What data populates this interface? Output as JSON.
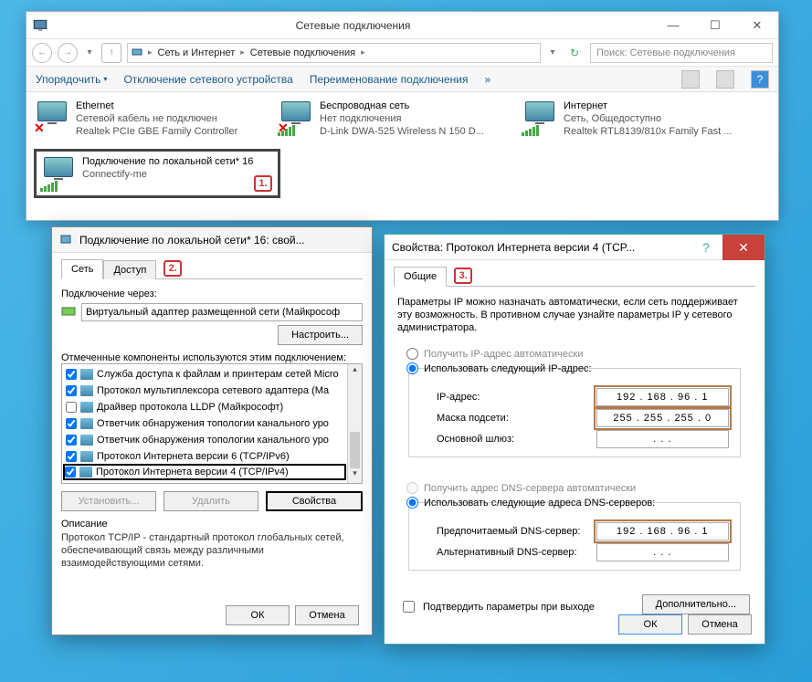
{
  "explorer": {
    "title": "Сетевые подключения",
    "back": "←",
    "fwd": "→",
    "up": "↑",
    "breadcrumb": {
      "seg1": "Сеть и Интернет",
      "seg2": "Сетевые подключения"
    },
    "search_placeholder": "Поиск: Сетевые подключения",
    "toolbar": {
      "arrange": "Упорядочить",
      "disable": "Отключение сетевого устройства",
      "rename": "Переименование подключения"
    },
    "connections": [
      {
        "name": "Ethernet",
        "status": "Сетевой кабель не подключен",
        "driver": "Realtek PCIe GBE Family Controller",
        "disconnected": true
      },
      {
        "name": "Беспроводная сеть",
        "status": "Нет подключения",
        "driver": "D-Link DWA-525 Wireless N 150 D...",
        "disconnected": true
      },
      {
        "name": "Интернет",
        "status": "Сеть, Общедоступно",
        "driver": "Realtek RTL8139/810x Family Fast ...",
        "disconnected": false
      }
    ],
    "selected": {
      "name": "Подключение по локальной сети* 16",
      "status": "Connectify-me"
    },
    "badge1": "1."
  },
  "dlg1": {
    "title": "Подключение по локальной сети* 16: свой...",
    "tabs": {
      "net": "Сеть",
      "access": "Доступ"
    },
    "badge2": "2.",
    "connect_via_label": "Подключение через:",
    "adapter": "Виртуальный адаптер размещенной сети (Майкрософ",
    "configure": "Настроить...",
    "components_label": "Отмеченные компоненты используются этим подключением:",
    "items": [
      {
        "checked": true,
        "text": "Служба доступа к файлам и принтерам сетей Micro"
      },
      {
        "checked": true,
        "text": "Протокол мультиплексора сетевого адаптера (Ма"
      },
      {
        "checked": false,
        "text": "Драйвер протокола LLDP (Майкрософт)"
      },
      {
        "checked": true,
        "text": "Ответчик обнаружения топологии канального уро"
      },
      {
        "checked": true,
        "text": "Ответчик обнаружения топологии канального уро"
      },
      {
        "checked": true,
        "text": "Протокол Интернета версии 6 (TCP/IPv6)"
      },
      {
        "checked": true,
        "text": "Протокол Интернета версии 4 (TCP/IPv4)"
      }
    ],
    "install": "Установить...",
    "remove": "Удалить",
    "properties": "Свойства",
    "desc_label": "Описание",
    "desc": "Протокол TCP/IP - стандартный протокол глобальных сетей, обеспечивающий связь между различными взаимодействующими сетями.",
    "ok": "ОК",
    "cancel": "Отмена"
  },
  "dlg2": {
    "title": "Свойства: Протокол Интернета версии 4 (TCP...",
    "tab_general": "Общие",
    "badge3": "3.",
    "intro": "Параметры IP можно назначать автоматически, если сеть поддерживает эту возможность. В противном случае узнайте параметры IP у сетевого администратора.",
    "auto_ip": "Получить IP-адрес автоматически",
    "use_ip": "Использовать следующий IP-адрес:",
    "ip_label": "IP-адрес:",
    "ip_val": "192 . 168 . 96 .  1",
    "mask_label": "Маска подсети:",
    "mask_val": "255 . 255 . 255 .  0",
    "gw_label": "Основной шлюз:",
    "gw_val": " .   .   . ",
    "auto_dns": "Получить адрес DNS-сервера автоматически",
    "use_dns": "Использовать следующие адреса DNS-серверов:",
    "dns1_label": "Предпочитаемый DNS-сервер:",
    "dns1_val": "192 . 168 . 96 .  1",
    "dns2_label": "Альтернативный DNS-сервер:",
    "dns2_val": " .   .   . ",
    "confirm": "Подтвердить параметры при выходе",
    "advanced": "Дополнительно...",
    "ok": "ОК",
    "cancel": "Отмена"
  }
}
